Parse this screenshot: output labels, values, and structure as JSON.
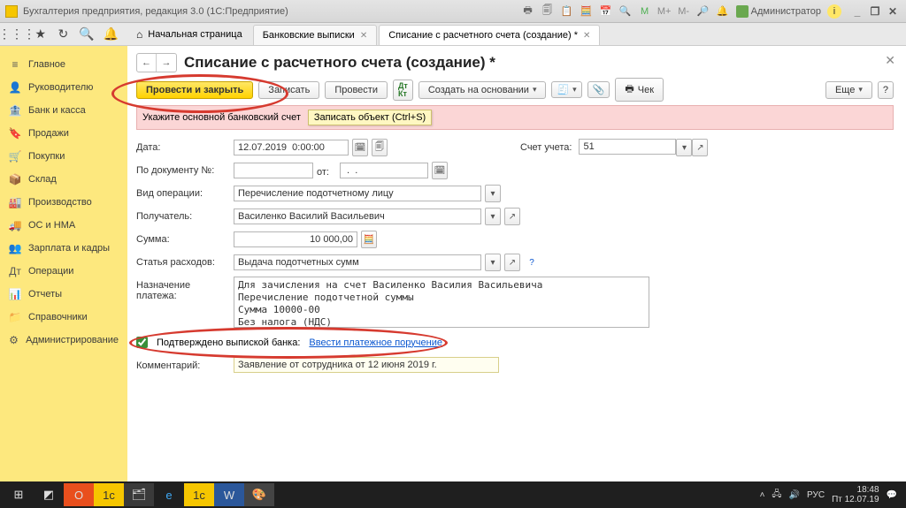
{
  "window": {
    "title": "Бухгалтерия предприятия, редакция 3.0   (1С:Предприятие)",
    "admin": "Администратор"
  },
  "toptabs": {
    "home": "Начальная страница",
    "tab1": "Банковские выписки",
    "tab2": "Списание с расчетного счета (создание) *"
  },
  "sidebar": [
    {
      "icon": "≡",
      "label": "Главное"
    },
    {
      "icon": "👤",
      "label": "Руководителю"
    },
    {
      "icon": "🏦",
      "label": "Банк и касса"
    },
    {
      "icon": "🔖",
      "label": "Продажи"
    },
    {
      "icon": "🛒",
      "label": "Покупки"
    },
    {
      "icon": "📦",
      "label": "Склад"
    },
    {
      "icon": "🏭",
      "label": "Производство"
    },
    {
      "icon": "🚚",
      "label": "ОС и НМА"
    },
    {
      "icon": "👥",
      "label": "Зарплата и кадры"
    },
    {
      "icon": "Дт",
      "label": "Операции"
    },
    {
      "icon": "📊",
      "label": "Отчеты"
    },
    {
      "icon": "📁",
      "label": "Справочники"
    },
    {
      "icon": "⚙",
      "label": "Администрирование"
    }
  ],
  "page": {
    "title": "Списание с расчетного счета (создание) *"
  },
  "cmd": {
    "post_close": "Провести и закрыть",
    "save": "Записать",
    "post": "Провести",
    "dtkt": "Дт\nКт",
    "create_base": "Создать на основании",
    "cheque": "Чек",
    "more": "Еще"
  },
  "hint": {
    "text": "Укажите основной банковский счет",
    "tooltip": "Записать объект (Ctrl+S)"
  },
  "labels": {
    "date": "Дата:",
    "docnum": "По документу №:",
    "ot": "от:",
    "acc": "Счет учета:",
    "optype": "Вид операции:",
    "receiver": "Получатель:",
    "sum": "Сумма:",
    "cost": "Статья расходов:",
    "purpose": "Назначение\nплатежа:",
    "confirmed": "Подтверждено выпиской банка:",
    "link": "Ввести платежное поручение",
    "comment": "Комментарий:"
  },
  "values": {
    "date": "12.07.2019  0:00:00",
    "ot": " .  .    ",
    "acc": "51",
    "optype": "Перечисление подотчетному лицу",
    "receiver": "Василенко Василий Васильевич",
    "sum": "10 000,00",
    "cost": "Выдача подотчетных сумм",
    "purpose": "Для зачисления на счет Василенко Василия Васильевича\nПеречисление подотчетной суммы\nСумма 10000-00\nБез налога (НДС)",
    "comment": "Заявление от сотрудника от 12 июня 2019 г."
  },
  "taskbar": {
    "lang": "РУС",
    "time": "18:48",
    "date": "Пт 12.07.19"
  }
}
